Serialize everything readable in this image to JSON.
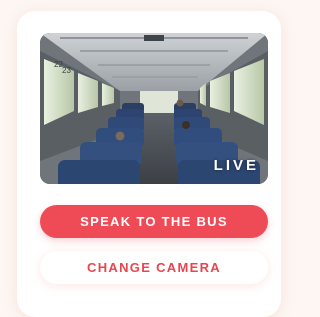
{
  "camera": {
    "live_label": "LIVE",
    "seat_numbers": [
      "22",
      "23"
    ]
  },
  "actions": {
    "speak_label": "SPEAK TO THE BUS",
    "change_camera_label": "CHANGE CAMERA"
  },
  "colors": {
    "accent": "#ee4b57",
    "secondary_text": "#e8464f",
    "background": "#fdf6f2",
    "card": "#ffffff"
  }
}
